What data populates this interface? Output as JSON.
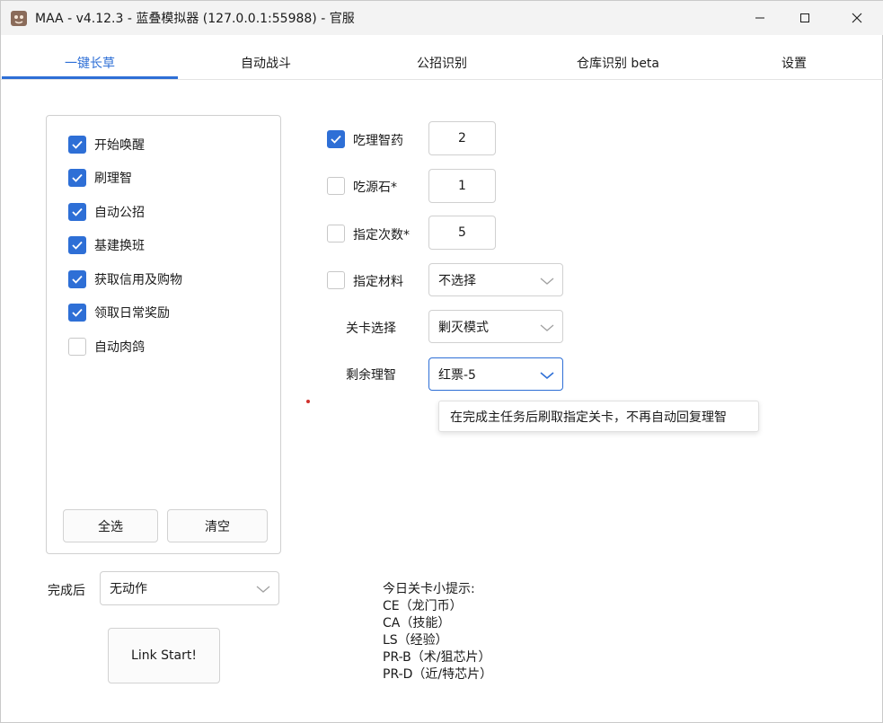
{
  "window": {
    "title": "MAA - v4.12.3 - 蓝叠模拟器 (127.0.0.1:55988) - 官服"
  },
  "tabs": [
    {
      "label": "一键长草",
      "active": true
    },
    {
      "label": "自动战斗",
      "active": false
    },
    {
      "label": "公招识别",
      "active": false
    },
    {
      "label": "仓库识别 beta",
      "active": false
    },
    {
      "label": "设置",
      "active": false
    }
  ],
  "tasks": [
    {
      "label": "开始唤醒",
      "checked": true
    },
    {
      "label": "刷理智",
      "checked": true
    },
    {
      "label": "自动公招",
      "checked": true
    },
    {
      "label": "基建换班",
      "checked": true
    },
    {
      "label": "获取信用及购物",
      "checked": true
    },
    {
      "label": "领取日常奖励",
      "checked": true
    },
    {
      "label": "自动肉鸽",
      "checked": false
    }
  ],
  "task_buttons": {
    "select_all": "全选",
    "clear": "清空"
  },
  "after_completion": {
    "label": "完成后",
    "value": "无动作"
  },
  "start_button": "Link Start!",
  "fight_settings": {
    "use_medicine": {
      "label": "吃理智药",
      "checked": true,
      "value": "2"
    },
    "use_stone": {
      "label": "吃源石*",
      "checked": false,
      "value": "1"
    },
    "times": {
      "label": "指定次数*",
      "checked": false,
      "value": "5"
    },
    "drops": {
      "label": "指定材料",
      "checked": false,
      "value": "不选择"
    },
    "stage": {
      "label": "关卡选择",
      "value": "剿灭模式"
    },
    "remaining_sanity": {
      "label": "剩余理智",
      "value": "红票-5"
    }
  },
  "tooltip": "在完成主任务后刷取指定关卡，不再自动回复理智",
  "tips": {
    "title": "今日关卡小提示:",
    "lines": [
      "CE（龙门币）",
      "CA（技能）",
      "LS（经验）",
      "PR-B（术/狙芯片）",
      "PR-D（近/特芯片）"
    ]
  },
  "colors": {
    "accent": "#2e6fd6",
    "tooltip_dot": "#d0312d"
  }
}
